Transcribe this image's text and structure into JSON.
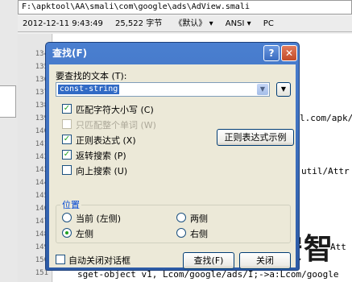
{
  "editor": {
    "path": "F:\\apktool\\AA\\smali\\com\\google\\ads\\AdView.smali",
    "info": {
      "datetime": "2012-12-11  9:43:49",
      "size": "25,522 字节",
      "encoding_default": "《默认》 ▾",
      "charset": "ANSI ▾",
      "line_ending": "PC"
    },
    "line_numbers": [
      "134",
      "135",
      "136",
      "137",
      "138",
      "139",
      "140",
      "141",
      "142",
      "143",
      "144",
      "145",
      "146",
      "147",
      "148",
      "149",
      "150",
      "151"
    ],
    "code_fragments": {
      "frag1": "l.com/apk/",
      "frag2": "util/Attr",
      "frag3": "Att",
      "frag4": "sget-object v1, Lcom/google/ads/I;->a:Lcom/google"
    }
  },
  "dialog": {
    "title": "查找(F)",
    "help_label": "?",
    "close_label": "✕",
    "find_label": "要查找的文本 (T):",
    "find_value": "const-string",
    "combo_arrow": "▼",
    "history_arrow": "▼",
    "options": [
      {
        "label": "匹配字符大小写 (C)",
        "checked": true,
        "enabled": true
      },
      {
        "label": "只匹配整个单词 (W)",
        "checked": false,
        "enabled": false
      },
      {
        "label": "正则表达式 (X)",
        "checked": true,
        "enabled": true
      },
      {
        "label": "返转搜索 (P)",
        "checked": true,
        "enabled": true
      },
      {
        "label": "向上搜索 (U)",
        "checked": false,
        "enabled": true
      }
    ],
    "regex_examples_button": "正则表达式示例",
    "position_title": "位置",
    "positions": [
      {
        "label": "当前 (左侧)",
        "selected": false
      },
      {
        "label": "两侧",
        "selected": false
      },
      {
        "label": "左侧",
        "selected": true
      },
      {
        "label": "右侧",
        "selected": false
      }
    ],
    "find_button": "查找(F)",
    "close_button": "关闭",
    "auto_close_label": "自动关闭对话框",
    "auto_close_checked": false
  },
  "watermark": {
    "text": "安智"
  }
}
